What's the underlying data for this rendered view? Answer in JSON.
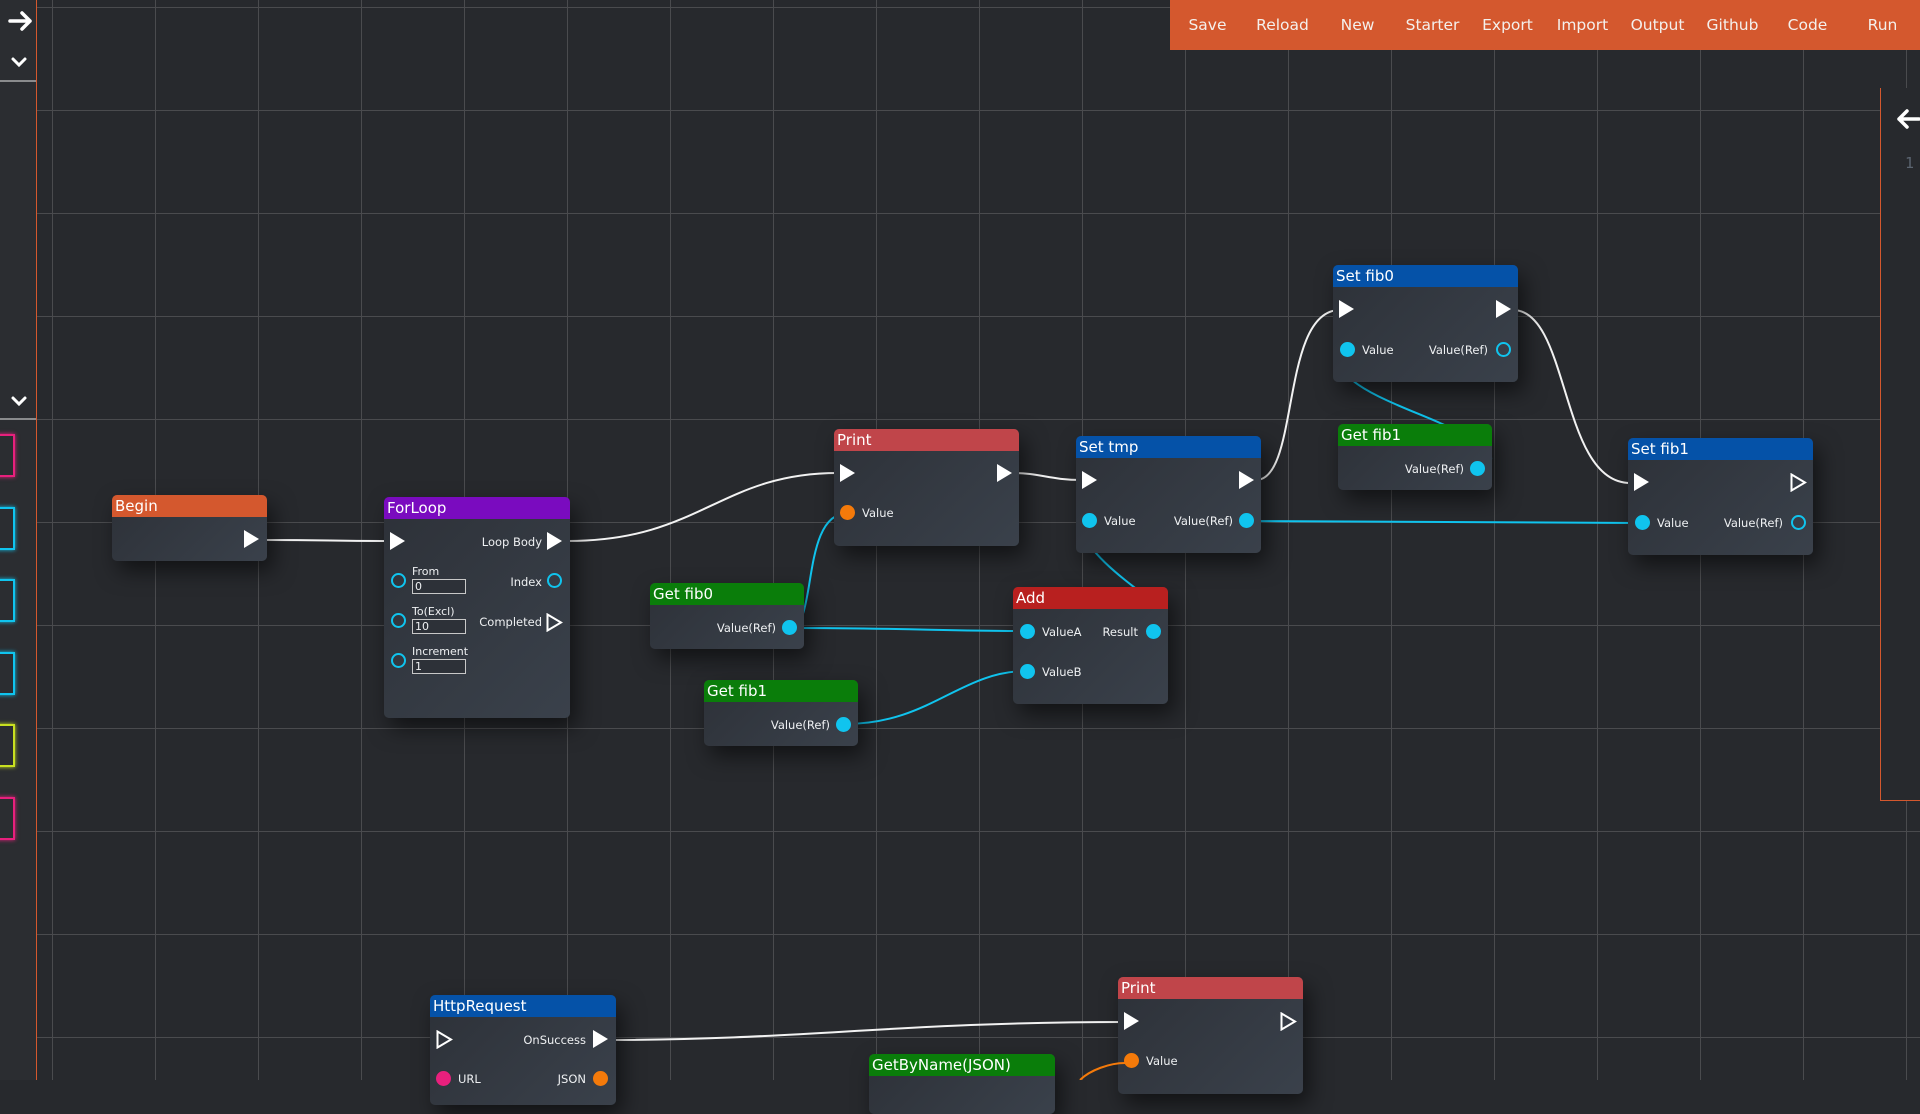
{
  "toolbar": {
    "buttons": [
      "Save",
      "Reload",
      "New",
      "Starter",
      "Export",
      "Import",
      "Output",
      "Github",
      "Code",
      "Run"
    ],
    "accent_color": "#d4582e"
  },
  "left_panel": {
    "toggle_icon": "arrow-right-icon",
    "sections": [
      "chevron-down-icon",
      "chevron-down-icon"
    ],
    "swatches": [
      {
        "type": "pink",
        "color": "#e8207d"
      },
      {
        "type": "cyan",
        "color": "#10c4ee"
      },
      {
        "type": "cyan",
        "color": "#10c4ee"
      },
      {
        "type": "cyan",
        "color": "#10c4ee"
      },
      {
        "type": "yellow",
        "color": "#c8e020"
      },
      {
        "type": "pink",
        "color": "#e8207d"
      }
    ]
  },
  "right_panel": {
    "toggle_icon": "arrow-left-icon",
    "line_number": "1"
  },
  "nodes": {
    "begin": {
      "title": "Begin",
      "color": "#d4582e"
    },
    "forloop": {
      "title": "ForLoop",
      "color": "#7a0bbf",
      "outputs": {
        "loop_body": "Loop Body",
        "index": "Index",
        "completed": "Completed"
      },
      "inputs": {
        "from": {
          "label": "From",
          "value": "0"
        },
        "to": {
          "label": "To(Excl)",
          "value": "10"
        },
        "increment": {
          "label": "Increment",
          "value": "1"
        }
      }
    },
    "print1": {
      "title": "Print",
      "color": "#c0454a",
      "value_label": "Value"
    },
    "get_fib0": {
      "title": "Get fib0",
      "color": "#0a7d0a",
      "output_label": "Value(Ref)"
    },
    "get_fib1_a": {
      "title": "Get fib1",
      "color": "#0a7d0a",
      "output_label": "Value(Ref)"
    },
    "set_tmp": {
      "title": "Set tmp",
      "color": "#0552a8",
      "value_label": "Value",
      "output_label": "Value(Ref)"
    },
    "add": {
      "title": "Add",
      "color": "#b8201f",
      "a_label": "ValueA",
      "b_label": "ValueB",
      "result_label": "Result"
    },
    "set_fib0": {
      "title": "Set fib0",
      "color": "#0552a8",
      "value_label": "Value",
      "output_label": "Value(Ref)"
    },
    "get_fib1_b": {
      "title": "Get fib1",
      "color": "#0a7d0a",
      "output_label": "Value(Ref)"
    },
    "set_fib1": {
      "title": "Set fib1",
      "color": "#0552a8",
      "value_label": "Value",
      "output_label": "Value(Ref)"
    },
    "http_request": {
      "title": "HttpRequest",
      "color": "#0552a8",
      "on_success": "OnSuccess",
      "url_label": "URL",
      "json_label": "JSON"
    },
    "get_by_name": {
      "title": "GetByName(JSON)",
      "color": "#0a7d0a"
    },
    "print2": {
      "title": "Print",
      "color": "#c0454a",
      "value_label": "Value"
    }
  }
}
